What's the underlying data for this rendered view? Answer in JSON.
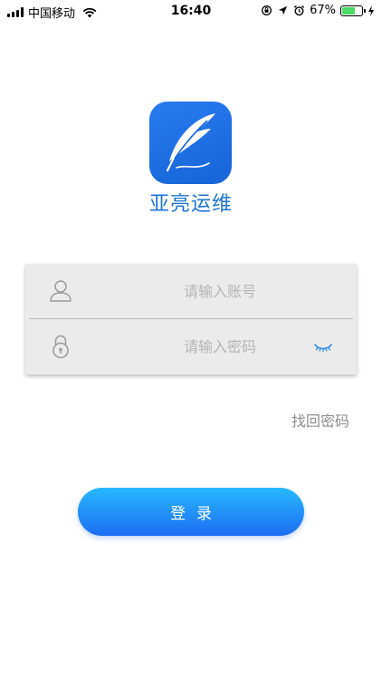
{
  "status_bar": {
    "carrier": "中国移动",
    "time": "16:40",
    "battery_percent": "67%",
    "battery_level": 0.67,
    "icons": [
      "signal-icon",
      "wifi-icon",
      "orientation-lock-icon",
      "location-icon",
      "alarm-icon",
      "battery-icon",
      "charging-icon"
    ]
  },
  "app": {
    "name": "亚亮运维",
    "logo_icon": "quill-feather-icon",
    "brand_color": "#1e73d2"
  },
  "form": {
    "account_placeholder": "请输入账号",
    "account_value": "",
    "account_icon": "user-icon",
    "password_placeholder": "请输入密码",
    "password_value": "",
    "password_icon": "lock-icon",
    "visibility_icon": "eye-closed-icon",
    "forgot_label": "找回密码",
    "login_label": "登录"
  },
  "colors": {
    "button_gradient_top": "#27b8ff",
    "button_gradient_bottom": "#1d6df2",
    "card_background": "#ebebeb",
    "forgot_text": "#8d8d8d"
  }
}
